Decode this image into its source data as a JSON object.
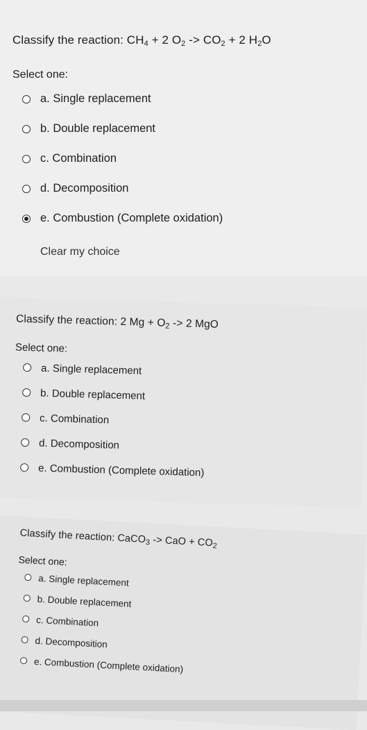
{
  "questions": [
    {
      "stem": {
        "a": "Classify the reaction: CH",
        "s1": "4",
        "b": " + 2 O",
        "s2": "2",
        "c": " -> CO",
        "s3": "2",
        "d": " + 2 H",
        "s4": "2",
        "e": "O"
      },
      "select_one": "Select one:",
      "options": [
        {
          "label": "a. Single replacement",
          "checked": false
        },
        {
          "label": "b. Double replacement",
          "checked": false
        },
        {
          "label": "c. Combination",
          "checked": false
        },
        {
          "label": "d. Decomposition",
          "checked": false
        },
        {
          "label": "e. Combustion (Complete oxidation)",
          "checked": true
        }
      ],
      "clear_label": "Clear my choice"
    },
    {
      "stem": {
        "a": "Classify the reaction: 2 Mg + O",
        "s1": "2",
        "b": " -> 2 MgO"
      },
      "select_one": "Select one:",
      "options": [
        {
          "label": "a. Single replacement",
          "checked": false
        },
        {
          "label": "b. Double replacement",
          "checked": false
        },
        {
          "label": "c. Combination",
          "checked": false
        },
        {
          "label": "d. Decomposition",
          "checked": false
        },
        {
          "label": "e. Combustion (Complete oxidation)",
          "checked": false
        }
      ]
    },
    {
      "stem": {
        "a": "Classify the reaction: CaCO",
        "s1": "3",
        "b": " -> CaO + CO",
        "s2": "2"
      },
      "select_one": "Select one:",
      "options": [
        {
          "label": "a. Single replacement",
          "checked": false
        },
        {
          "label": "b. Double replacement",
          "checked": false
        },
        {
          "label": "c. Combination",
          "checked": false
        },
        {
          "label": "d. Decomposition",
          "checked": false
        },
        {
          "label": "e. Combustion (Complete oxidation)",
          "checked": false
        }
      ]
    }
  ]
}
